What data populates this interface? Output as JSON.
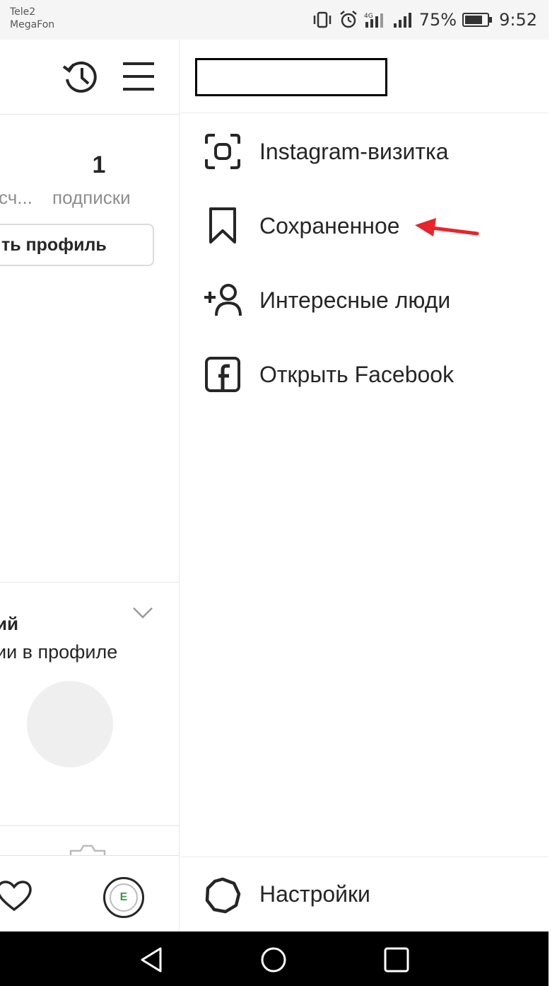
{
  "status_bar": {
    "carrier_1": "Tele2",
    "carrier_2": "MegaFon",
    "battery": "75%",
    "time": "9:52",
    "icons": [
      "vibrate-icon",
      "alarm-icon",
      "signal-4g-icon",
      "signal-icon",
      "battery-icon"
    ]
  },
  "profile": {
    "following_count": "1",
    "followers_label": "сч...",
    "following_label": "подписки",
    "edit_profile_label": "ть профиль",
    "discover_title": "ий",
    "discover_subtitle": "ии в профиле",
    "profile_tab_letter": "E"
  },
  "drawer": {
    "menu_items": [
      {
        "label": "Instagram-визитка",
        "icon": "nametag-icon"
      },
      {
        "label": "Сохраненное",
        "icon": "bookmark-icon"
      },
      {
        "label": "Интересные люди",
        "icon": "add-person-icon"
      },
      {
        "label": "Открыть Facebook",
        "icon": "facebook-icon"
      }
    ],
    "settings_label": "Настройки",
    "highlight_color": "#e8232a"
  }
}
